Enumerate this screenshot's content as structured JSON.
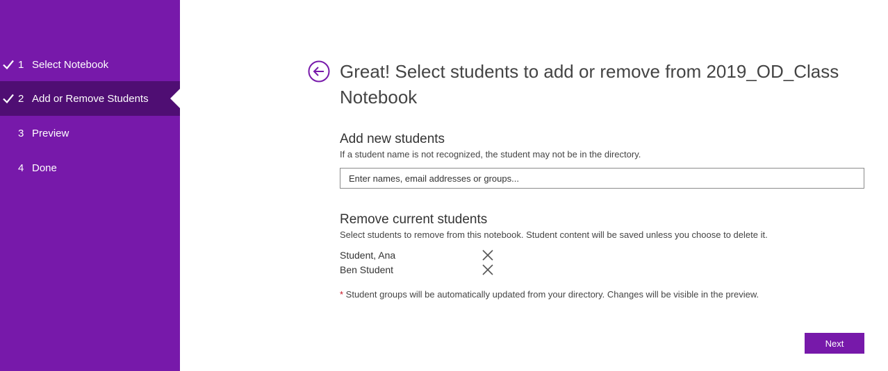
{
  "sidebar": {
    "steps": [
      {
        "num": "1",
        "label": "Select Notebook",
        "checked": true
      },
      {
        "num": "2",
        "label": "Add or Remove Students",
        "checked": true,
        "active": true
      },
      {
        "num": "3",
        "label": "Preview",
        "checked": false
      },
      {
        "num": "4",
        "label": "Done",
        "checked": false
      }
    ]
  },
  "main": {
    "title": "Great! Select students to add or remove from 2019_OD_Class Notebook",
    "add_section": {
      "heading": "Add new students",
      "subtext": "If a student name is not recognized, the student may not be in the directory.",
      "input_placeholder": "Enter names, email addresses or groups..."
    },
    "remove_section": {
      "heading": "Remove current students",
      "subtext": "Select students to remove from this notebook. Student content will be saved unless you choose to delete it.",
      "students": [
        "Student, Ana",
        "Ben Student"
      ]
    },
    "note": {
      "marker": "*",
      "text": " Student groups will be automatically updated from your directory. Changes will be visible in the preview."
    },
    "next_label": "Next"
  },
  "colors": {
    "sidebar": "#7719aa",
    "sidebar_active": "#4f0e73",
    "accent": "#7719aa",
    "required_marker": "#c50f1f"
  }
}
